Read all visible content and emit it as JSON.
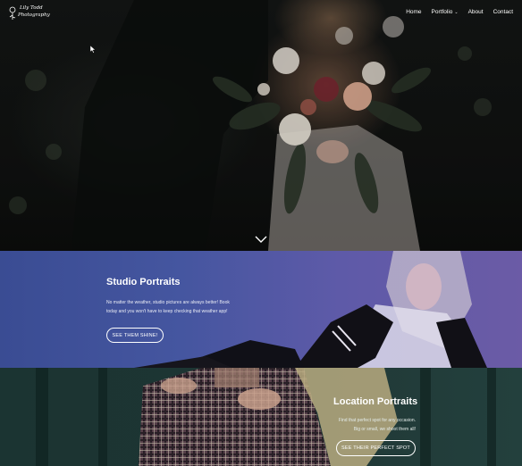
{
  "brand": {
    "logo_text_line1": "Lily Todd",
    "logo_text_line2": "Photography",
    "logo_icon": "flower-icon"
  },
  "nav": {
    "items": [
      {
        "label": "Home",
        "has_dropdown": false
      },
      {
        "label": "Portfolio",
        "has_dropdown": true
      },
      {
        "label": "About",
        "has_dropdown": false
      },
      {
        "label": "Contact",
        "has_dropdown": false
      }
    ]
  },
  "hero": {
    "scroll_icon": "chevron-down-icon"
  },
  "studio": {
    "title": "Studio Portraits",
    "description": "No matter the weather, studio pictures are always better! Book today and you won't have to keep checking that weather app!",
    "button_label": "SEE THEM SHINE!"
  },
  "location": {
    "title": "Location Portraits",
    "description": "Find that perfect spot for any occasion. Big or small, we shoot them all!",
    "button_label": "SEE THEIR PERFECT SPOT"
  },
  "colors": {
    "studio_gradient_start": "#3a4c93",
    "studio_gradient_end": "#6b5ba6",
    "location_bg": "#1d3533",
    "hero_bg": "#121413"
  }
}
